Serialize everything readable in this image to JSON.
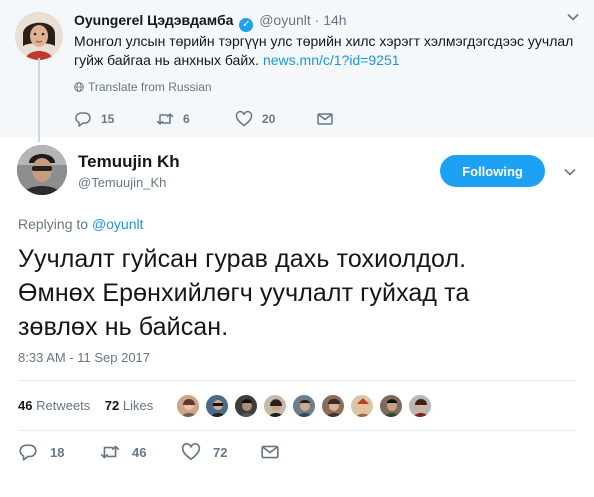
{
  "parent_tweet": {
    "name": "Oyungerel Цэдэвдамба",
    "handle": "@oyunlt",
    "separator": "·",
    "time": "14h",
    "text": "Монгол улсын төрийн тэргүүн улс төрийн хилс хэрэгт хэлмэгдэгсдээс уучлал гуйж байгаа нь анхных байх.",
    "link": "news.mn/c/1?id=9251",
    "translate": "Translate from Russian",
    "replies": "15",
    "retweets": "6",
    "likes": "20",
    "verified_icon": "verified-badge-icon",
    "accent": "#1da1f2"
  },
  "main_tweet": {
    "name": "Temuujin Kh",
    "handle": "@Temuujin_Kh",
    "follow_label": "Following",
    "replying_prefix": "Replying to",
    "replying_handle": "@oyunlt",
    "text_line1": "Уучлалт гуйсан гурав дахь тохиолдол.",
    "text_line2": "Өмнөх Ерөнхийлөгч уучлалт гуйхад та",
    "text_line3": "зөвлөх нь байсан.",
    "timestamp": "8:33 AM - 11 Sep 2017",
    "retweets_count": "46",
    "retweets_label": "Retweets",
    "likes_count": "72",
    "likes_label": "Likes",
    "reply_count": "18",
    "retweet_count_action": "46",
    "like_count_action": "72"
  },
  "colors": {
    "link": "#1b95e0",
    "secondary_text": "#657786",
    "parent_bg": "#f5f8fa",
    "button_bg": "#1da1f2"
  }
}
